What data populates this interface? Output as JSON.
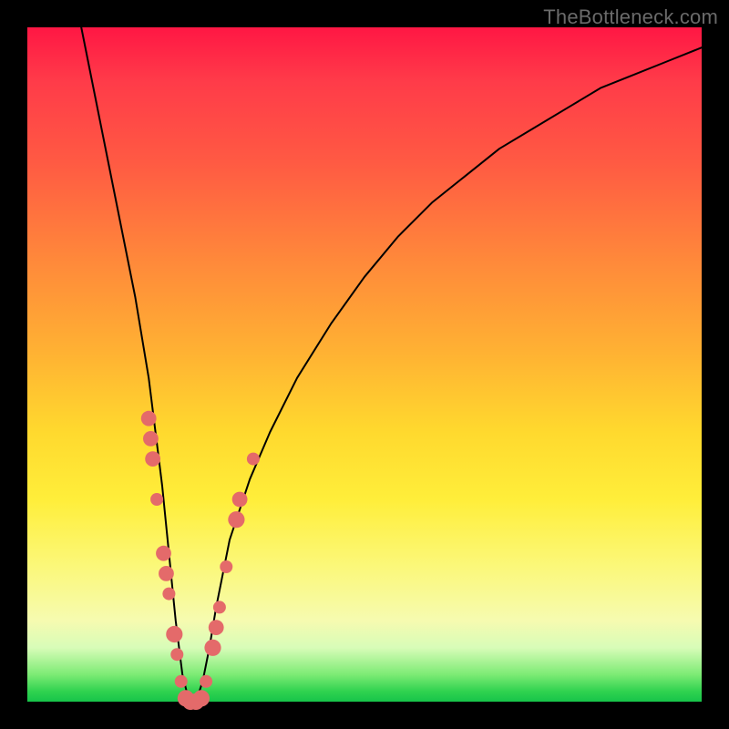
{
  "watermark": "TheBottleneck.com",
  "colors": {
    "curve_stroke": "#000000",
    "marker_fill": "#e46a6a",
    "marker_stroke": "#c04848"
  },
  "chart_data": {
    "type": "line",
    "title": "",
    "xlabel": "",
    "ylabel": "",
    "xlim": [
      0,
      100
    ],
    "ylim": [
      0,
      100
    ],
    "note": "Bottleneck-style V-curve. x is relative horizontal position (0–100, left→right), y is bottleneck percentage (0 at valley floor, 100 at top). Values estimated from pixels; no axis ticks are rendered in the source image.",
    "series": [
      {
        "name": "bottleneck-curve",
        "x": [
          8,
          10,
          12,
          14,
          16,
          18,
          19,
          20,
          21,
          22,
          23,
          24,
          25,
          26,
          27,
          28,
          30,
          33,
          36,
          40,
          45,
          50,
          55,
          60,
          65,
          70,
          75,
          80,
          85,
          90,
          95,
          100
        ],
        "y": [
          100,
          90,
          80,
          70,
          60,
          48,
          40,
          32,
          22,
          12,
          4,
          0,
          0,
          3,
          8,
          14,
          24,
          33,
          40,
          48,
          56,
          63,
          69,
          74,
          78,
          82,
          85,
          88,
          91,
          93,
          95,
          97
        ]
      }
    ],
    "markers": [
      {
        "x": 18.0,
        "y": 42,
        "r": 1.2
      },
      {
        "x": 18.3,
        "y": 39,
        "r": 1.2
      },
      {
        "x": 18.6,
        "y": 36,
        "r": 1.2
      },
      {
        "x": 19.2,
        "y": 30,
        "r": 1.0
      },
      {
        "x": 20.2,
        "y": 22,
        "r": 1.2
      },
      {
        "x": 20.6,
        "y": 19,
        "r": 1.2
      },
      {
        "x": 21.0,
        "y": 16,
        "r": 1.0
      },
      {
        "x": 21.8,
        "y": 10,
        "r": 1.3
      },
      {
        "x": 22.2,
        "y": 7,
        "r": 1.0
      },
      {
        "x": 22.8,
        "y": 3,
        "r": 1.0
      },
      {
        "x": 23.5,
        "y": 0.5,
        "r": 1.3
      },
      {
        "x": 24.2,
        "y": 0,
        "r": 1.3
      },
      {
        "x": 25.0,
        "y": 0,
        "r": 1.3
      },
      {
        "x": 25.8,
        "y": 0.5,
        "r": 1.3
      },
      {
        "x": 26.5,
        "y": 3,
        "r": 1.0
      },
      {
        "x": 27.5,
        "y": 8,
        "r": 1.3
      },
      {
        "x": 28.0,
        "y": 11,
        "r": 1.2
      },
      {
        "x": 28.5,
        "y": 14,
        "r": 1.0
      },
      {
        "x": 29.5,
        "y": 20,
        "r": 1.0
      },
      {
        "x": 31.0,
        "y": 27,
        "r": 1.3
      },
      {
        "x": 31.5,
        "y": 30,
        "r": 1.2
      },
      {
        "x": 33.5,
        "y": 36,
        "r": 1.0
      }
    ]
  }
}
